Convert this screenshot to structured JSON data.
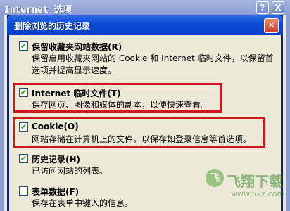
{
  "outer_window": {
    "title": "Internet 选项",
    "help_label": "?",
    "close_label": "X"
  },
  "dialog": {
    "title": "删除浏览的历史记录",
    "close_label": "✕"
  },
  "options": [
    {
      "label": "保留收藏夹网站数据(R)",
      "description": "保留启用收藏夹网站的 Cookie 和 Internet 临时文件，以保留首选项并提高显示速度。",
      "checked": true,
      "highlighted": false
    },
    {
      "label": "Internet 临时文件(T)",
      "description": "保存网页、图像和媒体的副本，以便快速查看。",
      "checked": true,
      "highlighted": true
    },
    {
      "label": "Cookie(O)",
      "description": "网站存储在计算机上的文件，以保存如登录信息等首选项。",
      "checked": true,
      "highlighted": true
    },
    {
      "label": "历史记录(H)",
      "description": "已访问网站的列表。",
      "checked": true,
      "highlighted": false
    },
    {
      "label": "表单数据(F)",
      "description": "保存在表单中键入的信息。",
      "checked": false,
      "highlighted": false
    }
  ],
  "watermark": {
    "logo_char": "飞",
    "text": "飞翔下载",
    "url": "www.52z.com"
  },
  "colors": {
    "highlight_border": "#D0171E",
    "dialog_title_bar": "#0A4CD6",
    "window_background": "#ECE9D8",
    "check_mark": "#21A121"
  }
}
